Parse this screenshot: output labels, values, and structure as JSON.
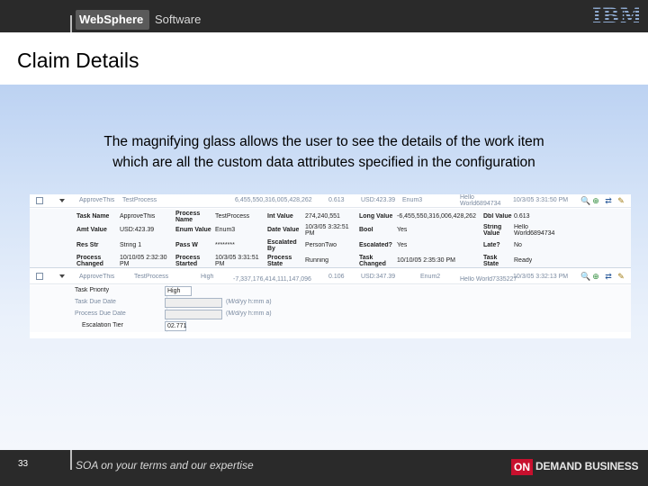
{
  "header": {
    "brand": "WebSphere",
    "product": "Software",
    "company_logo": "IBM"
  },
  "slide": {
    "title": "Claim Details",
    "caption_line1": "The magnifying glass allows the user to see the details of the work item",
    "caption_line2": "which are all the custom data attributes specified in the configuration"
  },
  "table": {
    "row1": {
      "cells": [
        "ApproveThis",
        "TestProcess",
        "6,455,550,316,005,428,262",
        "0.613",
        "USD:423.39",
        "Enum3",
        "Hello World6894734",
        "10/3/05 3:31:50 PM"
      ]
    },
    "details": {
      "r1": [
        {
          "label": "Task Name",
          "value": "ApproveThis"
        },
        {
          "label": "Process Name",
          "value": "TestProcess"
        },
        {
          "label": "Int Value",
          "value": "274,240,551"
        },
        {
          "label": "Long Value",
          "value": "-6,455,550,316,006,428,262"
        },
        {
          "label": "Dbl Value",
          "value": "0.613"
        }
      ],
      "r2": [
        {
          "label": "Amt Value",
          "value": "USD:423.39"
        },
        {
          "label": "Enum Value",
          "value": "Enum3"
        },
        {
          "label": "Date Value",
          "value": "10/3/05 3:32:51 PM"
        },
        {
          "label": "Bool",
          "value": "Yes"
        },
        {
          "label": "String Value",
          "value": "Hello World6894734"
        }
      ],
      "r3": [
        {
          "label": "Res Str",
          "value": "String 1"
        },
        {
          "label": "Pass W",
          "value": "********"
        },
        {
          "label": "Escalated By",
          "value": "PersonTwo"
        },
        {
          "label": "Escalated?",
          "value": "Yes"
        },
        {
          "label": "Late?",
          "value": "No"
        }
      ],
      "r4": [
        {
          "label": "Process Changed",
          "value": "10/10/05 2:32:30 PM"
        },
        {
          "label": "Process Started",
          "value": "10/3/05 3:31:51 PM"
        },
        {
          "label": "Process State",
          "value": "Running"
        },
        {
          "label": "Task Changed",
          "value": "10/10/05 2:35:30 PM"
        },
        {
          "label": "Task State",
          "value": "Ready"
        }
      ]
    },
    "row2": {
      "cells": [
        "ApproveThis",
        "TestProcess",
        "High",
        "-7,337,176,414,111,147,096",
        "0.106",
        "USD:347.39",
        "Enum2",
        "Hello World7335227",
        "10/3/05 3:32:13 PM"
      ]
    },
    "form": {
      "fields": [
        {
          "label": "Task Priority",
          "value": "High"
        },
        {
          "label": "Task Due Date",
          "value": "",
          "hint": "(M/d/yy h:mm a)"
        },
        {
          "label": "Process Due Date",
          "value": "",
          "hint": "(M/d/yy h:mm a)"
        },
        {
          "label": "Escalation Tier",
          "value": "02.771"
        }
      ]
    }
  },
  "footer": {
    "page_number": "33",
    "tagline": "SOA on your terms and our expertise",
    "badge_on": "ON",
    "badge_text": "DEMAND BUSINESS"
  },
  "colors": {
    "header_bg": "#2a2a2a",
    "gradient_top": "#bcd2f2",
    "on_demand_red": "#c8102e"
  },
  "icons": [
    "checkbox-icon",
    "expand-arrow-icon",
    "magnifier-icon",
    "add-icon",
    "transfer-icon",
    "edit-icon"
  ]
}
